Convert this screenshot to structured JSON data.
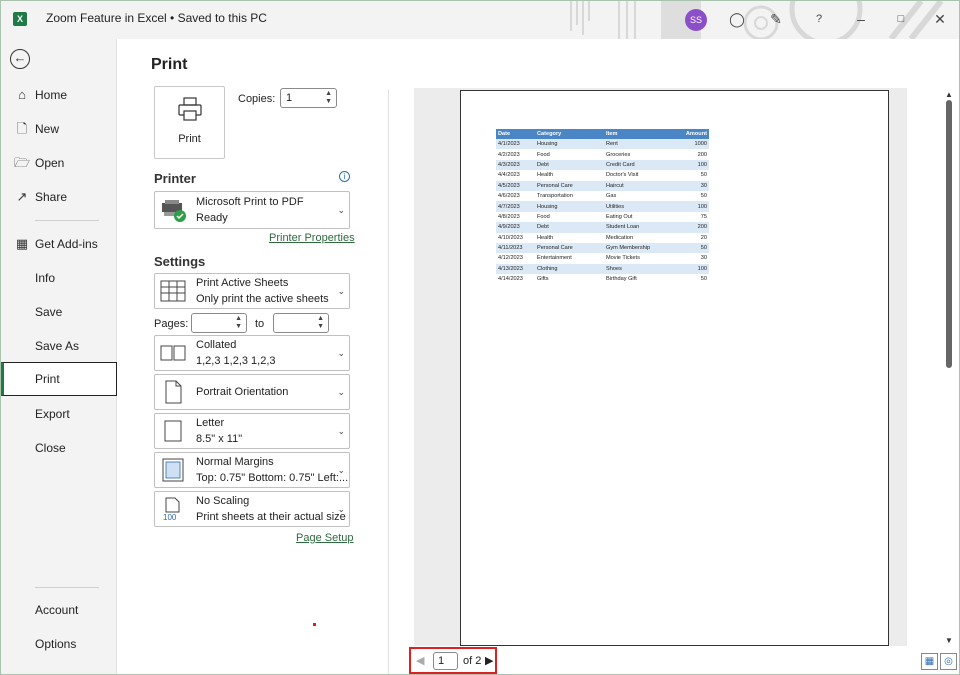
{
  "titlebar": {
    "app_title": "Zoom Feature in Excel • Saved to this PC",
    "logo_letter": "X",
    "avatar_initials": "SS",
    "icons": [
      "lightbulb-icon",
      "comment-icon",
      "help-icon",
      "minimize-icon",
      "restore-icon",
      "close-icon"
    ]
  },
  "leftnav": {
    "items": [
      {
        "label": "Home",
        "icon": "home-icon"
      },
      {
        "label": "New",
        "icon": "new-file-icon"
      },
      {
        "label": "Open",
        "icon": "folder-open-icon"
      },
      {
        "label": "Share",
        "icon": "share-icon"
      },
      {
        "label": "Get Add-ins",
        "icon": "addins-icon"
      },
      {
        "label": "Info"
      },
      {
        "label": "Save"
      },
      {
        "label": "Save As"
      },
      {
        "label": "Print",
        "active": true
      },
      {
        "label": "Export"
      },
      {
        "label": "Close"
      }
    ],
    "bottom_items": [
      {
        "label": "Account"
      },
      {
        "label": "Options"
      }
    ]
  },
  "print": {
    "heading": "Print",
    "button_label": "Print",
    "copies_label": "Copies:",
    "copies_value": "1",
    "printer_heading": "Printer",
    "printer_name": "Microsoft Print to PDF",
    "printer_status": "Ready",
    "printer_properties_link": "Printer Properties",
    "settings_heading": "Settings",
    "sheets_title": "Print Active Sheets",
    "sheets_sub": "Only print the active sheets",
    "pages_label": "Pages:",
    "to_label": "to",
    "pages_from": "",
    "pages_to": "",
    "collate_title": "Collated",
    "collate_sub": "1,2,3   1,2,3   1,2,3",
    "orientation_title": "Portrait Orientation",
    "paper_title": "Letter",
    "paper_sub": "8.5\" x 11\"",
    "margins_title": "Normal Margins",
    "margins_sub": "Top: 0.75\" Bottom: 0.75\" Left:...",
    "scaling_title": "No Scaling",
    "scaling_sub": "Print sheets at their actual size",
    "scaling_icon_text": "100",
    "page_setup_link": "Page Setup"
  },
  "preview": {
    "headers": [
      "Date",
      "Category",
      "Item",
      "Amount"
    ],
    "rows": [
      [
        "4/1/2023",
        "Housing",
        "Rent",
        "1000"
      ],
      [
        "4/2/2023",
        "Food",
        "Groceries",
        "200"
      ],
      [
        "4/3/2023",
        "Debt",
        "Credit Card",
        "100"
      ],
      [
        "4/4/2023",
        "Health",
        "Doctor's Visit",
        "50"
      ],
      [
        "4/5/2023",
        "Personal Care",
        "Haircut",
        "30"
      ],
      [
        "4/6/2023",
        "Transportation",
        "Gas",
        "50"
      ],
      [
        "4/7/2023",
        "Housing",
        "Utilities",
        "100"
      ],
      [
        "4/8/2023",
        "Food",
        "Eating Out",
        "75"
      ],
      [
        "4/9/2023",
        "Debt",
        "Student Loan",
        "200"
      ],
      [
        "4/10/2023",
        "Health",
        "Medication",
        "20"
      ],
      [
        "4/11/2023",
        "Personal Care",
        "Gym Membership",
        "50"
      ],
      [
        "4/12/2023",
        "Entertainment",
        "Movie Tickets",
        "30"
      ],
      [
        "4/13/2023",
        "Clothing",
        "Shoes",
        "100"
      ],
      [
        "4/14/2023",
        "Gifts",
        "Birthday Gift",
        "50"
      ]
    ],
    "header_color": "#4a86c5",
    "alt_row_color": "#dbe8f5"
  },
  "pager": {
    "current_page": "1",
    "total_label": "of 2"
  },
  "colors": {
    "accent": "#1f7a45",
    "highlight_border": "#e02020"
  }
}
